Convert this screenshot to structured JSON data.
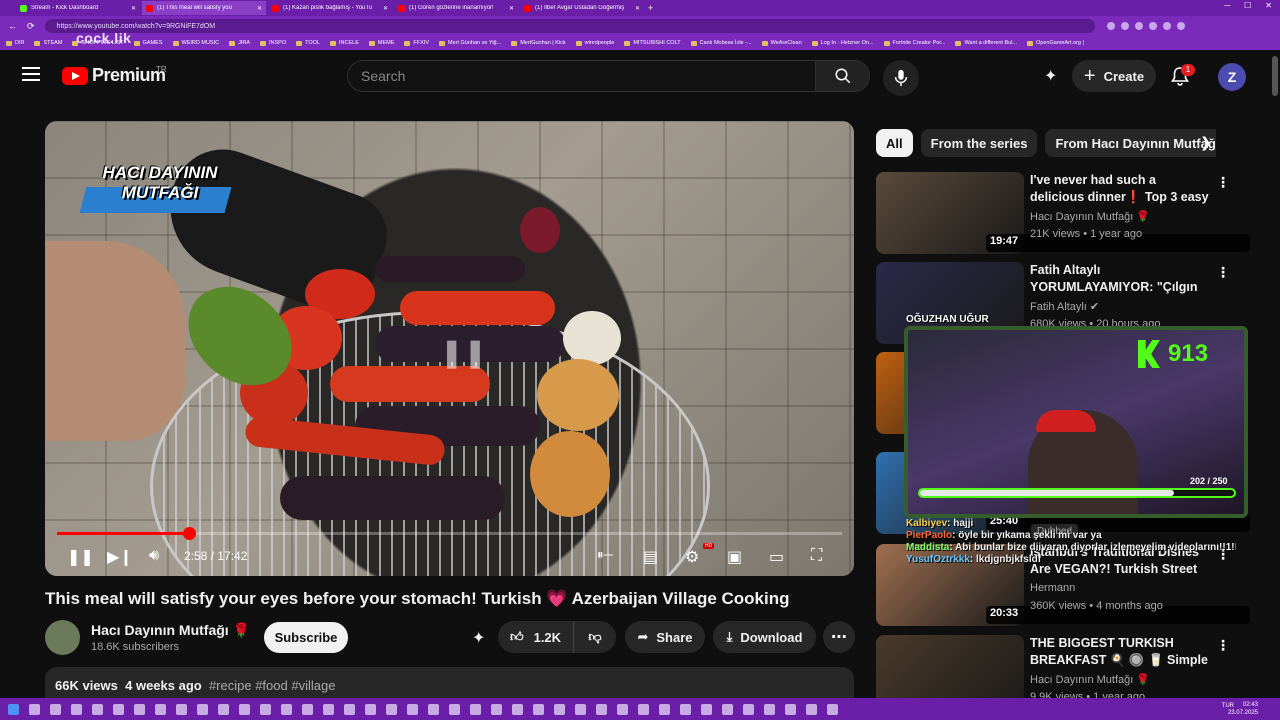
{
  "browser": {
    "tabs": [
      {
        "label": "Stream - Kick Dashboard",
        "color": "#53fc18"
      },
      {
        "label": "(1) This meal will satisfy you",
        "color": "#ff0000"
      },
      {
        "label": "(1) Kazan pislik bağlamış - YouTu",
        "color": "#ff0000"
      },
      {
        "label": "(1) Gören gözlerine inanamıyor!",
        "color": "#ff0000"
      },
      {
        "label": "(1) İlber Avgar Ustadan Göğermiş",
        "color": "#ff0000"
      }
    ],
    "new_tab": "+",
    "url": "https://www.youtube.com/watch?v=9RGNiFE7dOM",
    "bookmarks": [
      "DIR",
      "STEAM",
      "SHOPPING LIST",
      "GAMES",
      "WEIRD MUSIC",
      "JIRA",
      "INSPO",
      "TOOL",
      "INCELE",
      "MEME",
      "FFXIV",
      "Mert Günhan ve Yiğ...",
      "MertGunhan | Kick",
      "wiredpeople",
      "MITSUBISHI COLT",
      "Canlı Mobese İzle -...",
      "WeAreClean",
      "Log In - Hetzner On...",
      "Fortnite Creator Por...",
      "Want a different Bul...",
      "OpenGameArt.org |"
    ],
    "watermark": "cock.lik"
  },
  "header": {
    "logo_text": "Premium",
    "region": "TR",
    "search_placeholder": "Search",
    "create_label": "Create",
    "notification_count": "1",
    "avatar_letter": "Z"
  },
  "player": {
    "overlay_title_line1": "HACI DAYININ",
    "overlay_title_line2": "MUTFAĞI",
    "current_time": "2:58",
    "duration": "17:42",
    "progress_fraction": 0.1676,
    "hd_badge": "HD"
  },
  "video": {
    "title": "This meal will satisfy your eyes before your stomach! Turkish 💗 Azerbaijan Village Cooking",
    "channel_name": "Hacı Dayının Mutfağı 🌹",
    "subscribers": "18.6K subscribers",
    "subscribe_label": "Subscribe",
    "likes": "1.2K",
    "share_label": "Share",
    "download_label": "Download",
    "views": "66K views",
    "age": "4 weeks ago",
    "tags": "#recipe #food #village"
  },
  "sidebar": {
    "chips": [
      "All",
      "From the series",
      "From Hacı Dayının Mutfağı"
    ],
    "recommendations": [
      {
        "title": "I've never had such a delicious dinner❗ Top 3 easy recipes...",
        "channel": "Hacı Dayının Mutfağı 🌹",
        "meta": "21K views • 1 year ago",
        "duration": "19:47",
        "thumb": "#5a4a3a"
      },
      {
        "title": "Fatih Altaylı YORUMLAYAMIYOR: \"Çılgın ...",
        "channel": "Fatih Altaylı ✔",
        "meta": "680K views • 20 hours ago",
        "duration": "",
        "thumb_caption": "OĞUZHAN UĞUR",
        "thumb": "#2a2a4a"
      },
      {
        "title": "",
        "channel": "",
        "meta": "",
        "duration": "",
        "thumb": "#c06010"
      },
      {
        "title": "",
        "channel": "",
        "meta": "",
        "duration": "25:40",
        "thumb": "#3070b0"
      },
      {
        "title": "Istanbul's Traditional Dishes Are VEGAN?! Turkish Street Food ...",
        "channel": "Hermann",
        "meta": "360K views • 4 months ago",
        "duration": "20:33",
        "thumb": "#a07050"
      },
      {
        "title": "THE BIGGEST TURKISH BREAKFAST 🍳 🔘 🥛 Simple ...",
        "channel": "Hacı Dayının Mutfağı 🌹",
        "meta": "9.9K views • 1 year ago",
        "duration": "",
        "thumb": "#4a3a2a"
      }
    ],
    "dubbed_label": "Dubbed"
  },
  "stream_overlay": {
    "follower_count": "913",
    "goal_text": "202 / 250",
    "goal_fraction": 0.808,
    "chat": [
      {
        "user": "Kalbiyev",
        "text": ": hajji",
        "color": "#ffd24a"
      },
      {
        "user": "PierPaolo",
        "text": ": öyle bir yıkama şekli mi var ya",
        "color": "#ff6a3a"
      },
      {
        "user": "Maddista",
        "text": ": Abi bunlar bize diivaran diyorlar izlemeyelim videolarını!!1!!1",
        "color": "#7cff6a"
      },
      {
        "user": "YusufOztrkkk",
        "text": ": lkdjgnbjkfsldf",
        "color": "#6ac8ff"
      }
    ]
  },
  "taskbar": {
    "tray_lang": "TUR",
    "time": "02:43",
    "date": "23.07.2025"
  }
}
